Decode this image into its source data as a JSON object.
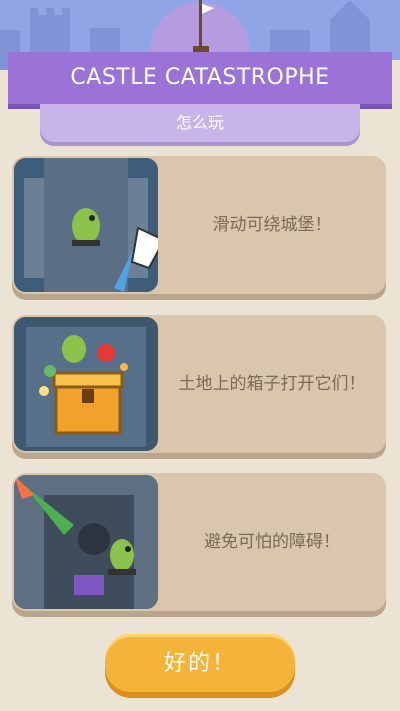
{
  "header": {
    "title": "CASTLE CATASTROPHE",
    "subtitle": "怎么玩"
  },
  "cards": [
    {
      "text": "滑动可绕城堡！",
      "image_icon": "tower-swipe-illustration"
    },
    {
      "text": "土地上的箱子打开它们！",
      "image_icon": "treasure-chest-illustration"
    },
    {
      "text": "避免可怕的障碍！",
      "image_icon": "dragon-obstacle-illustration"
    }
  ],
  "ok_button": {
    "label": "好的！"
  },
  "colors": {
    "banner": "#9b73d6",
    "subtab": "#c9b4ea",
    "card": "#d9c6ac",
    "button": "#f4b43a",
    "background": "#ebe3d4"
  }
}
